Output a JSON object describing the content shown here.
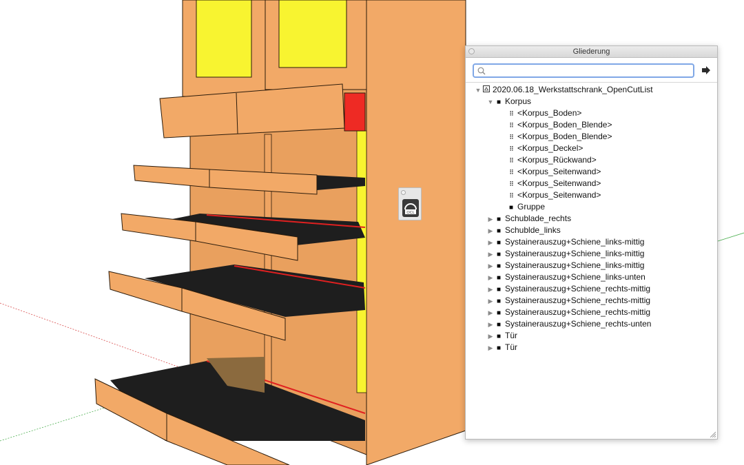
{
  "outliner": {
    "title": "Gliederung",
    "search": {
      "value": "",
      "placeholder": ""
    },
    "tree": [
      {
        "label": "2020.06.18_Werkstattschrank_OpenCutList",
        "level": 0,
        "expanded": true,
        "kind": "model"
      },
      {
        "label": "Korpus",
        "level": 1,
        "expanded": true,
        "kind": "group"
      },
      {
        "label": "<Korpus_Boden>",
        "level": 2,
        "kind": "component"
      },
      {
        "label": "<Korpus_Boden_Blende>",
        "level": 2,
        "kind": "component"
      },
      {
        "label": "<Korpus_Boden_Blende>",
        "level": 2,
        "kind": "component"
      },
      {
        "label": "<Korpus_Deckel>",
        "level": 2,
        "kind": "component"
      },
      {
        "label": "<Korpus_Rückwand>",
        "level": 2,
        "kind": "component"
      },
      {
        "label": "<Korpus_Seitenwand>",
        "level": 2,
        "kind": "component"
      },
      {
        "label": "<Korpus_Seitenwand>",
        "level": 2,
        "kind": "component"
      },
      {
        "label": "<Korpus_Seitenwand>",
        "level": 2,
        "kind": "component"
      },
      {
        "label": "Gruppe",
        "level": 2,
        "kind": "group"
      },
      {
        "label": "Schublade_rechts",
        "level": 1,
        "expanded": false,
        "kind": "group"
      },
      {
        "label": "Schublde_links",
        "level": 1,
        "expanded": false,
        "kind": "group"
      },
      {
        "label": "Systainerauszug+Schiene_links-mittig",
        "level": 1,
        "expanded": false,
        "kind": "group"
      },
      {
        "label": "Systainerauszug+Schiene_links-mittig",
        "level": 1,
        "expanded": false,
        "kind": "group"
      },
      {
        "label": "Systainerauszug+Schiene_links-mittig",
        "level": 1,
        "expanded": false,
        "kind": "group"
      },
      {
        "label": "Systainerauszug+Schiene_links-unten",
        "level": 1,
        "expanded": false,
        "kind": "group"
      },
      {
        "label": "Systainerauszug+Schiene_rechts-mittig",
        "level": 1,
        "expanded": false,
        "kind": "group"
      },
      {
        "label": "Systainerauszug+Schiene_rechts-mittig",
        "level": 1,
        "expanded": false,
        "kind": "group"
      },
      {
        "label": "Systainerauszug+Schiene_rechts-mittig",
        "level": 1,
        "expanded": false,
        "kind": "group"
      },
      {
        "label": "Systainerauszug+Schiene_rechts-unten",
        "level": 1,
        "expanded": false,
        "kind": "group"
      },
      {
        "label": "Tür",
        "level": 1,
        "expanded": false,
        "kind": "group"
      },
      {
        "label": "Tür",
        "level": 1,
        "expanded": false,
        "kind": "group"
      }
    ]
  },
  "toolbar": {
    "button_text": "OCL"
  },
  "colors": {
    "wood": "#F2A967",
    "wood_dark": "#D9894A",
    "panel_yellow": "#F8F430",
    "drawer_black": "#1E1E1E",
    "rail_red": "#E02020",
    "accent_red": "#EE2A24",
    "axis_red": "#D84A4A",
    "axis_green": "#4CAF50",
    "focus_blue": "#7FA7E6"
  },
  "icons": {
    "expanded": "triangle-down-icon",
    "collapsed": "triangle-right-icon",
    "group": "group-icon",
    "component": "component-icon",
    "model": "model-icon",
    "search": "search-icon",
    "details": "details-arrow-icon"
  }
}
